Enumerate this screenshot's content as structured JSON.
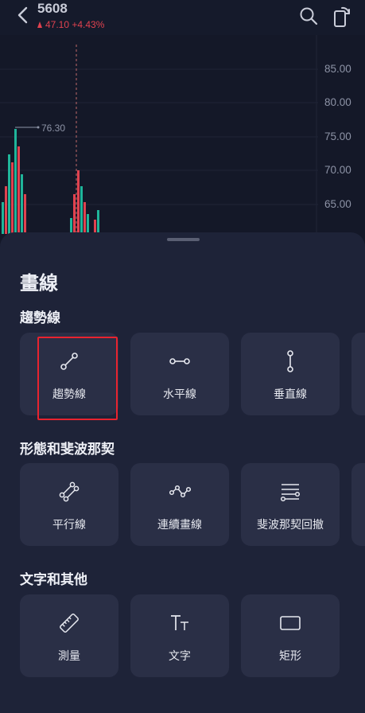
{
  "header": {
    "ticker": "5608",
    "change": "47.10 +4.43%",
    "colors": {
      "down": "#e0424f",
      "up": "#1fb59a"
    },
    "icons": [
      "back-arrow-icon",
      "search-icon",
      "rotate-screen-icon"
    ]
  },
  "chart": {
    "y_ticks": [
      "85.00",
      "80.00",
      "75.00",
      "70.00",
      "65.00"
    ],
    "high_label": "76.30"
  },
  "sheet": {
    "title": "畫線",
    "sections": [
      {
        "title": "趨勢線",
        "tools": [
          {
            "label": "趨勢線",
            "icon": "trend-line-icon",
            "selected": true
          },
          {
            "label": "水平線",
            "icon": "horizontal-line-icon"
          },
          {
            "label": "垂直線",
            "icon": "vertical-line-icon"
          }
        ]
      },
      {
        "title": "形態和斐波那契",
        "tools": [
          {
            "label": "平行線",
            "icon": "parallel-lines-icon"
          },
          {
            "label": "連續畫線",
            "icon": "polyline-icon"
          },
          {
            "label": "斐波那契回撤",
            "icon": "fibonacci-retracement-icon"
          }
        ]
      },
      {
        "title": "文字和其他",
        "tools": [
          {
            "label": "測量",
            "icon": "ruler-icon"
          },
          {
            "label": "文字",
            "icon": "text-icon"
          },
          {
            "label": "矩形",
            "icon": "rectangle-icon"
          }
        ]
      }
    ]
  },
  "colors": {
    "selection": "#e8232f",
    "sheet": "#1e2338",
    "tile": "#2a2f46"
  }
}
